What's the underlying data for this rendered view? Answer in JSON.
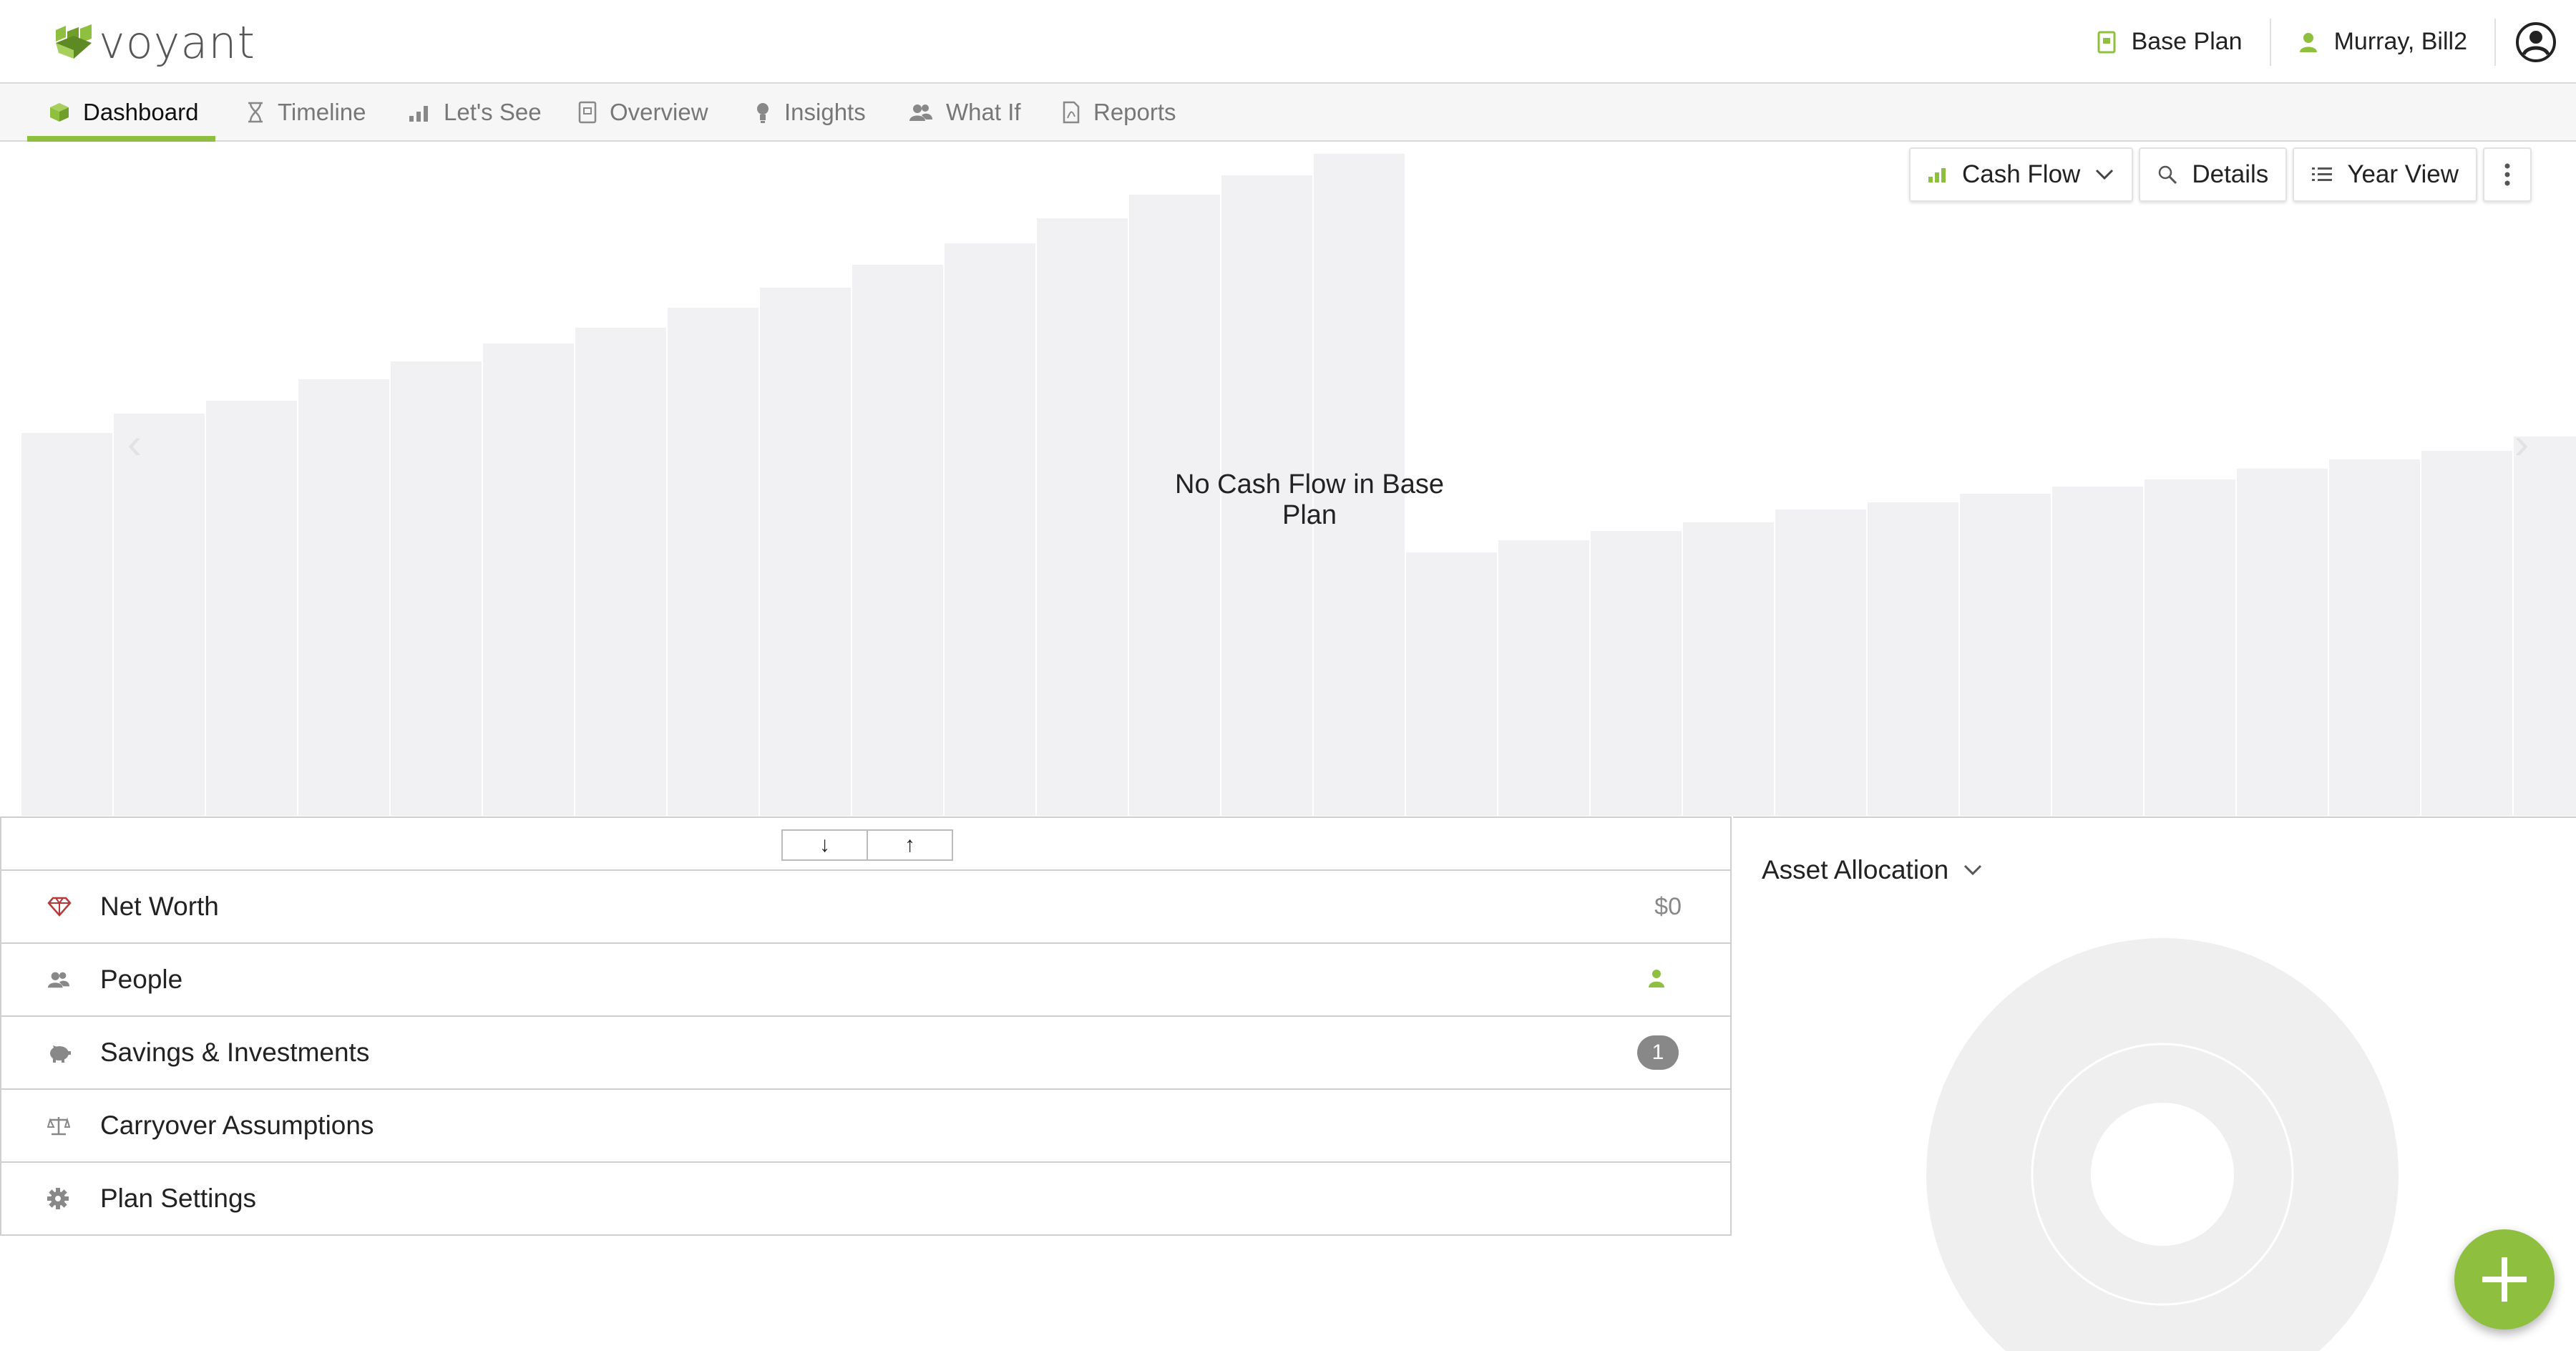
{
  "header": {
    "brand": "voyant",
    "plan": "Base Plan",
    "user": "Murray, Bill2"
  },
  "tabs": [
    {
      "label": "Dashboard",
      "icon": "cube-icon",
      "active": true
    },
    {
      "label": "Timeline",
      "icon": "hourglass-icon",
      "active": false
    },
    {
      "label": "Let's See",
      "icon": "bar-chart-icon",
      "active": false
    },
    {
      "label": "Overview",
      "icon": "document-icon",
      "active": false
    },
    {
      "label": "Insights",
      "icon": "lightbulb-icon",
      "active": false
    },
    {
      "label": "What If",
      "icon": "people-icon",
      "active": false
    },
    {
      "label": "Reports",
      "icon": "pdf-icon",
      "active": false
    }
  ],
  "toolbar": {
    "chart_select": "Cash Flow",
    "details": "Details",
    "year_view": "Year View"
  },
  "chart": {
    "empty_message": "No Cash Flow in Base Plan"
  },
  "sorter": {
    "down": "↓",
    "up": "↑"
  },
  "sections": [
    {
      "label": "Net Worth",
      "icon": "diamond-icon",
      "value": "$0"
    },
    {
      "label": "People",
      "icon": "people-icon",
      "value": ""
    },
    {
      "label": "Savings & Investments",
      "icon": "piggy-bank-icon",
      "badge": "1"
    },
    {
      "label": "Carryover Assumptions",
      "icon": "scales-icon",
      "value": ""
    },
    {
      "label": "Plan Settings",
      "icon": "gear-icon",
      "value": ""
    }
  ],
  "asset_allocation": {
    "title": "Asset Allocation"
  },
  "colors": {
    "accent": "#8ebf3f",
    "bar_placeholder": "#f1f1f4",
    "donut_placeholder": "#efefef"
  }
}
